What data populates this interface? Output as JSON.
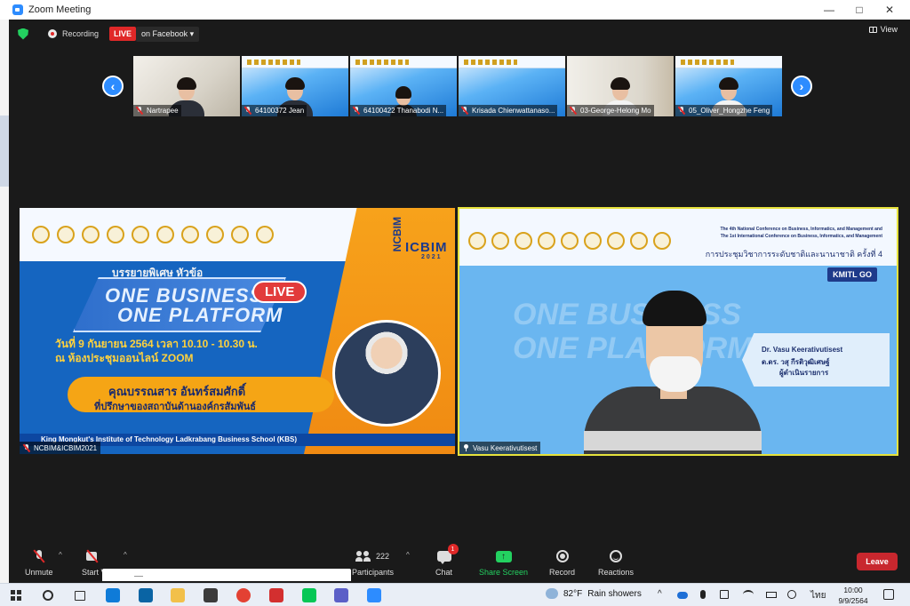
{
  "window": {
    "title": "Zoom Meeting",
    "min": "—",
    "max": "□",
    "close": "✕"
  },
  "topbar": {
    "recording_label": "Recording",
    "live_label": "LIVE",
    "live_destination": "on Facebook ▾",
    "view_label": "View"
  },
  "participants_strip": [
    {
      "name": "Nartrapee",
      "muted": true
    },
    {
      "name": "64100372 Jean",
      "muted": true
    },
    {
      "name": "64100422 Thanabodi N...",
      "muted": true
    },
    {
      "name": "Krisada Chienwattanaso...",
      "muted": true
    },
    {
      "name": "03-George-Helong Mo",
      "muted": true
    },
    {
      "name": "05_Oliver_Hongzhe Feng",
      "muted": true
    }
  ],
  "nav": {
    "prev": "‹",
    "next": "›"
  },
  "left_video": {
    "name": "NCBIM&ICBIM2021",
    "brand_vertical": "NCBIM",
    "brand_main": "ICBIM",
    "brand_year": "2021",
    "topic": "บรรยายพิเศษ หัวข้อ",
    "slogan_line1": "ONE BUSINESS",
    "slogan_line2": "ONE PLATFORM",
    "live_tag": "LIVE",
    "date": "วันที่ 9 กันยายน 2564  เวลา 10.10 - 10.30 น.",
    "venue": "ณ ห้องประชุมออนไลน์ ZOOM",
    "speaker": "คุณบรรณสาร อันทร์สมศักดิ์",
    "speaker_role": "ที่ปรึกษาของสถาบันด้านองค์กรสัมพันธ์",
    "footer": "King Mongkut's Institute of Technology Ladkrabang Business School (KBS)"
  },
  "right_video": {
    "name": "Vasu Keerativutisest",
    "conf_line1": "The 4th National Conference on Business, Informatics, and Management and",
    "conf_line2": "The 1st International Conference on Business, Informatics, and Management",
    "conf_thai": "การประชุมวิชาการระดับชาติและนานาชาติ ครั้งที่ 4",
    "kmitl": "KMITL GO",
    "ghost_line1": "ONE BUSINESS",
    "ghost_line2": "ONE PLATFORM",
    "card_name": "Dr. Vasu Keerativutisest",
    "card_thai": "ด.ดร. วสุ กีรติวุฒิเศษฐ์",
    "card_role": "ผู้ดำเนินรายการ"
  },
  "toolbar": {
    "unmute": "Unmute",
    "start_video": "Start V",
    "participants_count": "222",
    "participants": "Participants",
    "chat": "Chat",
    "chat_badge": "1",
    "share": "Share Screen",
    "share_glyph": "↑",
    "record": "Record",
    "reactions": "Reactions",
    "leave": "Leave",
    "caret": "^"
  },
  "taskbar": {
    "weather_temp": "82°F",
    "weather_desc": "Rain showers",
    "lang": "ไทย",
    "time": "10:00",
    "date": "9/9/2564",
    "tray_up": "^",
    "app_colors": [
      "#0f7bd8",
      "#0a64a4",
      "#f2c04a",
      "#3b3b3b",
      "#e34133",
      "#d32f2f",
      "#06c755",
      "#5b5fc7",
      "#2d8cff"
    ]
  }
}
